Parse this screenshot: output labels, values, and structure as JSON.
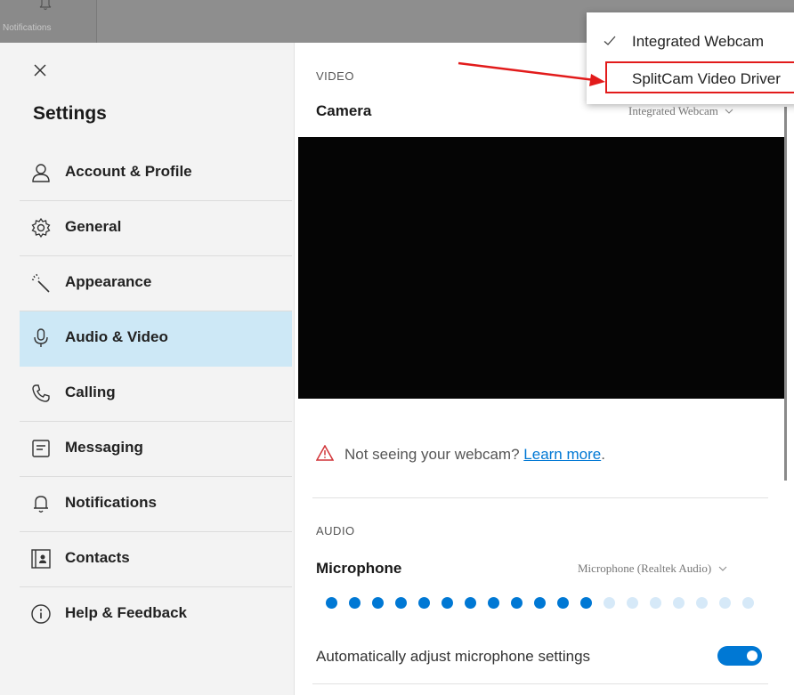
{
  "topbar": {
    "notifications_tab_label": "Notifications"
  },
  "sidebar": {
    "title": "Settings",
    "items": [
      {
        "label": "Account & Profile",
        "icon": "person-icon",
        "active": false
      },
      {
        "label": "General",
        "icon": "gear-icon",
        "active": false
      },
      {
        "label": "Appearance",
        "icon": "magic-wand-icon",
        "active": false
      },
      {
        "label": "Audio & Video",
        "icon": "microphone-icon",
        "active": true
      },
      {
        "label": "Calling",
        "icon": "phone-icon",
        "active": false
      },
      {
        "label": "Messaging",
        "icon": "message-icon",
        "active": false
      },
      {
        "label": "Notifications",
        "icon": "bell-icon",
        "active": false
      },
      {
        "label": "Contacts",
        "icon": "contact-card-icon",
        "active": false
      },
      {
        "label": "Help & Feedback",
        "icon": "info-icon",
        "active": false
      }
    ]
  },
  "video": {
    "section_label": "VIDEO",
    "camera_label": "Camera",
    "camera_value": "Integrated Webcam",
    "warning_text": "Not seeing your webcam?",
    "learn_more": "Learn more",
    "period": "."
  },
  "audio": {
    "section_label": "AUDIO",
    "microphone_label": "Microphone",
    "microphone_value": "Microphone (Realtek Audio)",
    "level_active": 12,
    "level_total": 19,
    "auto_adjust_label": "Automatically adjust microphone settings",
    "auto_adjust_on": true
  },
  "camera_dropdown": {
    "options": [
      "Integrated Webcam",
      "SplitCam Video Driver"
    ],
    "selected": "Integrated Webcam",
    "highlighted": "SplitCam Video Driver"
  },
  "colors": {
    "accent": "#0078d4",
    "active_nav_bg": "#cde8f6",
    "annotation_red": "#e21b1b",
    "level_inactive": "#d6e9f8"
  }
}
